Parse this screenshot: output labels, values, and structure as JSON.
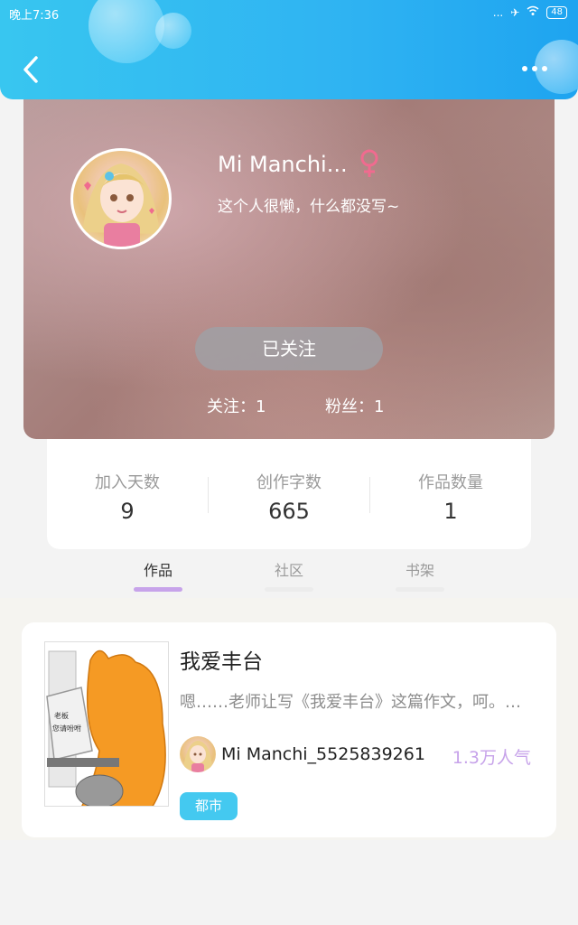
{
  "status_bar": {
    "time": "晚上7:36",
    "signal": "...",
    "battery": "48"
  },
  "header": {
    "back_icon": "chevron-left-icon",
    "more_icon": "more-horizontal-icon"
  },
  "profile": {
    "username": "Mi Manchi...",
    "gender_icon": "female-symbol-icon",
    "bio": "这个人很懒，什么都没写~",
    "follow_button": "已关注",
    "following_text": "关注：1",
    "followers_text": "粉丝：1"
  },
  "stats": [
    {
      "label": "加入天数",
      "value": "9"
    },
    {
      "label": "创作字数",
      "value": "665"
    },
    {
      "label": "作品数量",
      "value": "1"
    }
  ],
  "tabs": [
    {
      "label": "作品",
      "active": true
    },
    {
      "label": "社区",
      "active": false
    },
    {
      "label": "书架",
      "active": false
    }
  ],
  "works": [
    {
      "title": "我爱丰台",
      "description": "嗯……老师让写《我爱丰台》这篇作文，呵。…",
      "author": "Mi Manchi_5525839261",
      "popularity": "1.3万人气",
      "tag": "都市",
      "cover_text_line1": "老板",
      "cover_text_line2": "您请吩咐"
    }
  ],
  "colors": {
    "header": "#2fb3f2",
    "accent_purple": "#c7a3ea",
    "tag_blue": "#44c9f0",
    "gender_pink": "#f06b8f"
  }
}
